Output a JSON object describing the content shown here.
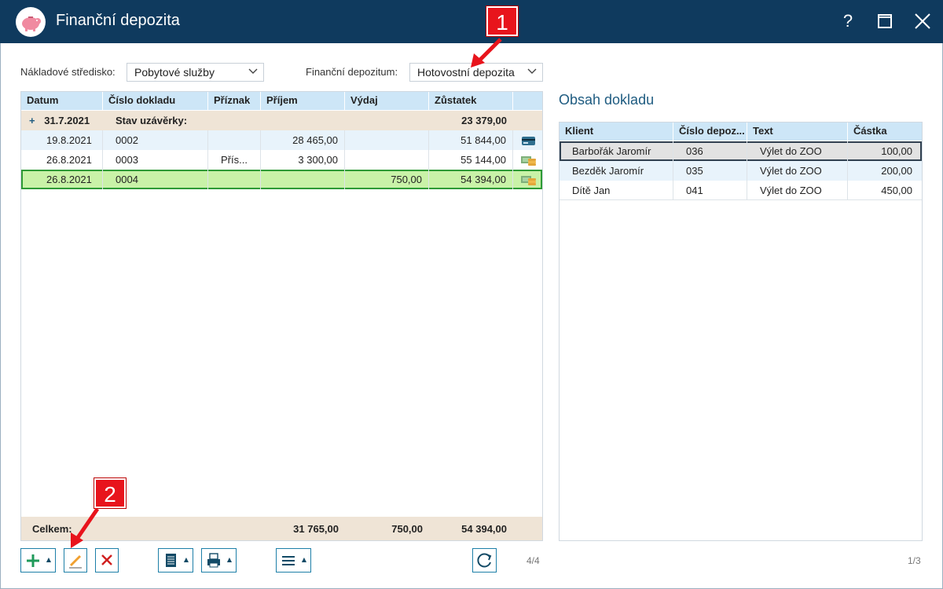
{
  "window": {
    "title": "Finanční depozita",
    "help_label": "?"
  },
  "filters": {
    "cost_center_label": "Nákladové středisko:",
    "cost_center_value": "Pobytové služby",
    "deposit_label": "Finanční depozitum:",
    "deposit_value": "Hotovostní depozita"
  },
  "main_grid": {
    "columns": [
      "Datum",
      "Číslo dokladu",
      "Příznak",
      "Příjem",
      "Výdaj",
      "Zůstatek"
    ],
    "group_row": {
      "expander": "+",
      "date": "31.7.2021",
      "label": "Stav uzávěrky:",
      "balance": "23 379,00"
    },
    "rows": [
      {
        "date": "19.8.2021",
        "doc": "0002",
        "flag": "",
        "income": "28 465,00",
        "expense": "",
        "balance": "51 844,00",
        "icon": "card-icon"
      },
      {
        "date": "26.8.2021",
        "doc": "0003",
        "flag": "Přís...",
        "income": "3 300,00",
        "expense": "",
        "balance": "55 144,00",
        "icon": "cash-icon"
      },
      {
        "date": "26.8.2021",
        "doc": "0004",
        "flag": "",
        "income": "",
        "expense": "750,00",
        "balance": "54 394,00",
        "icon": "cash-icon"
      }
    ],
    "footer": {
      "label": "Celkem:",
      "income": "31 765,00",
      "expense": "750,00",
      "balance": "54 394,00"
    },
    "pager": "4/4"
  },
  "detail": {
    "title": "Obsah dokladu",
    "columns": [
      "Klient",
      "Číslo depoz...",
      "Text",
      "Částka"
    ],
    "rows": [
      {
        "client": "Barbořák Jaromír",
        "num": "036",
        "text": "Výlet do ZOO",
        "amount": "100,00"
      },
      {
        "client": "Bezděk Jaromír",
        "num": "035",
        "text": "Výlet do ZOO",
        "amount": "200,00"
      },
      {
        "client": "Dítě Jan",
        "num": "041",
        "text": "Výlet do ZOO",
        "amount": "450,00"
      }
    ],
    "pager": "1/3"
  },
  "callouts": {
    "one": "1",
    "two": "2"
  },
  "colors": {
    "titlebar": "#0f3a5e",
    "header": "#cde6f7",
    "selected_row": "#c9f2a8",
    "group_row": "#efe4d6",
    "accent": "#1d7fa8",
    "callout": "#e8141c"
  }
}
